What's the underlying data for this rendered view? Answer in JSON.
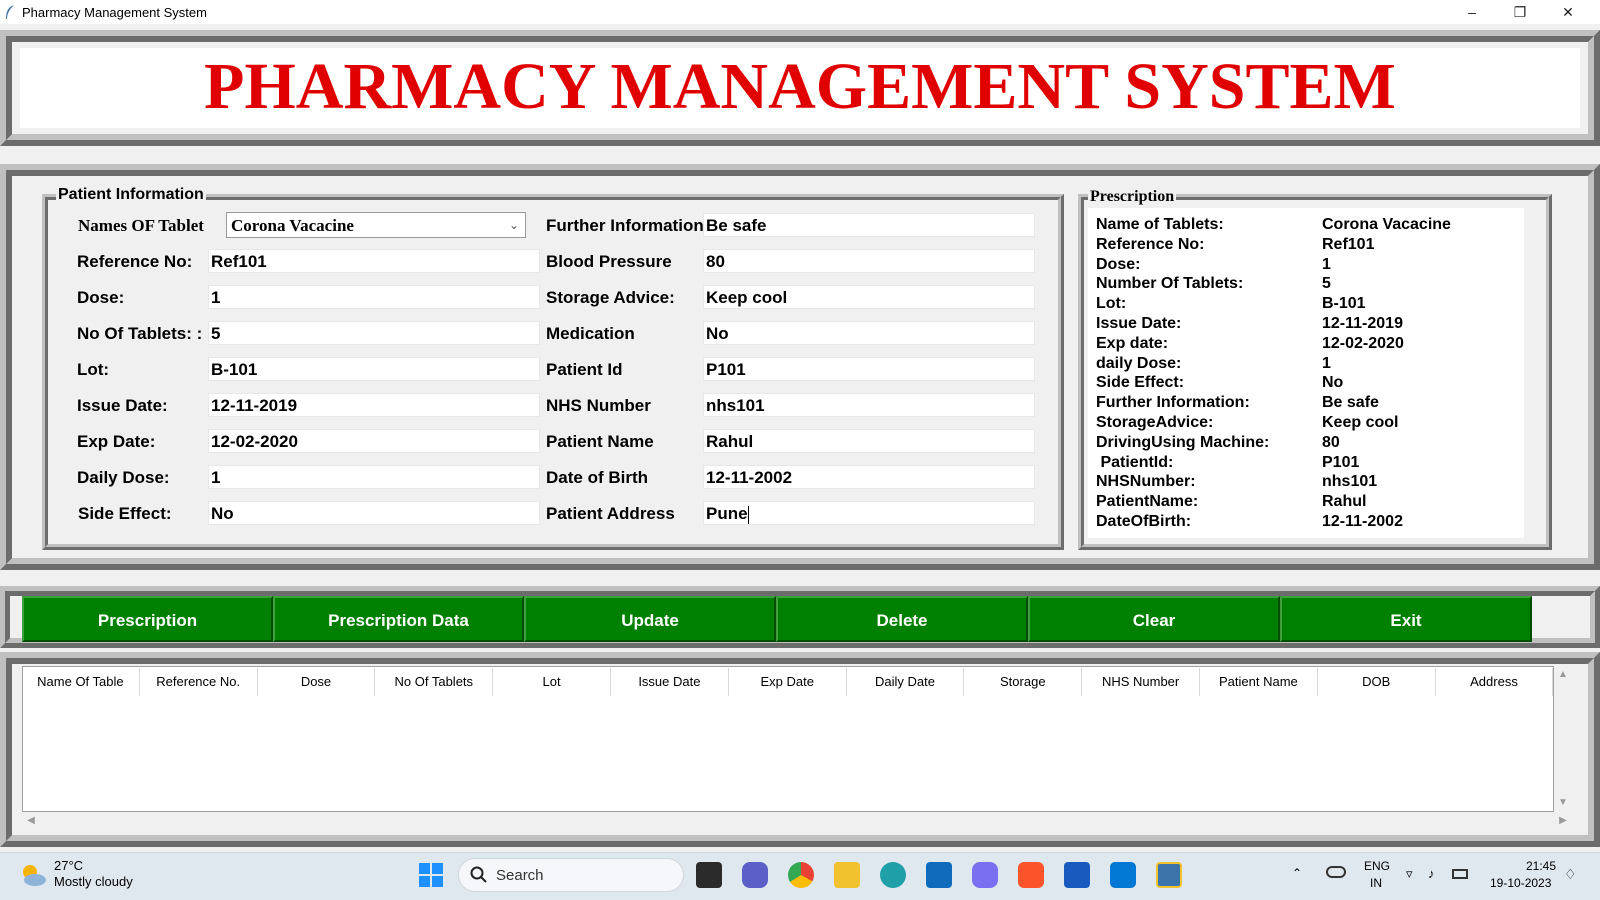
{
  "window": {
    "title": "Pharmacy Management System",
    "minimize": "–",
    "restore": "❐",
    "close": "✕"
  },
  "header": {
    "title": "PHARMACY MANAGEMENT SYSTEM"
  },
  "patient_info": {
    "legend": "Patient Information",
    "tablet_name_label": "Names OF Tablet",
    "tablet_name_value": "Corona Vacacine",
    "left_fields": [
      {
        "label": "Reference No:",
        "value": "Ref101"
      },
      {
        "label": "Dose:",
        "value": "1"
      },
      {
        "label": "No Of Tablets: :",
        "value": "5"
      },
      {
        "label": "Lot:",
        "value": "B-101"
      },
      {
        "label": "Issue Date:",
        "value": "12-11-2019"
      },
      {
        "label": "Exp Date:",
        "value": "12-02-2020"
      },
      {
        "label": "Daily Dose:",
        "value": "1"
      },
      {
        "label": "Side Effect:",
        "value": "No"
      }
    ],
    "right_fields": [
      {
        "label": "Further Information",
        "value": "Be safe"
      },
      {
        "label": "Blood Pressure",
        "value": "80"
      },
      {
        "label": "Storage Advice:",
        "value": "Keep cool"
      },
      {
        "label": "Medication",
        "value": "No"
      },
      {
        "label": "Patient Id",
        "value": "P101"
      },
      {
        "label": "NHS Number",
        "value": "nhs101"
      },
      {
        "label": "Patient Name",
        "value": "Rahul"
      },
      {
        "label": "Date of Birth",
        "value": "12-11-2002"
      },
      {
        "label": "Patient Address",
        "value": "Pune"
      }
    ]
  },
  "prescription": {
    "legend": "Prescription",
    "rows": [
      {
        "key": "Name of Tablets:",
        "value": "Corona Vacacine"
      },
      {
        "key": "Reference No:",
        "value": "Ref101"
      },
      {
        "key": "Dose:",
        "value": "1"
      },
      {
        "key": "Number Of Tablets:",
        "value": "5"
      },
      {
        "key": "Lot:",
        "value": "B-101"
      },
      {
        "key": "Issue Date:",
        "value": "12-11-2019"
      },
      {
        "key": "Exp date:",
        "value": "12-02-2020"
      },
      {
        "key": "daily Dose:",
        "value": "1"
      },
      {
        "key": "Side Effect:",
        "value": "No"
      },
      {
        "key": "Further Information:",
        "value": "Be safe"
      },
      {
        "key": "StorageAdvice:",
        "value": "Keep cool"
      },
      {
        "key": "DrivingUsing Machine:",
        "value": "80"
      },
      {
        "key": " PatientId:",
        "value": "P101"
      },
      {
        "key": "NHSNumber:",
        "value": "nhs101"
      },
      {
        "key": "PatientName:",
        "value": "Rahul"
      },
      {
        "key": "DateOfBirth:",
        "value": "12-11-2002"
      }
    ]
  },
  "buttons": [
    "Prescription",
    "Prescription Data",
    "Update",
    "Delete",
    "Clear",
    "Exit"
  ],
  "table": {
    "columns": [
      "Name Of Table",
      "Reference No.",
      "Dose",
      "No Of Tablets",
      "Lot",
      "Issue Date",
      "Exp Date",
      "Daily Date",
      "Storage",
      "NHS Number",
      "Patient Name",
      "DOB",
      "Address"
    ]
  },
  "taskbar": {
    "weather_temp": "27°C",
    "weather_desc": "Mostly cloudy",
    "search_placeholder": "Search",
    "lang_top": "ENG",
    "lang_bottom": "IN",
    "time": "21:45",
    "date": "19-10-2023"
  },
  "colors": {
    "title_red": "#e00000",
    "button_green": "#008000"
  }
}
